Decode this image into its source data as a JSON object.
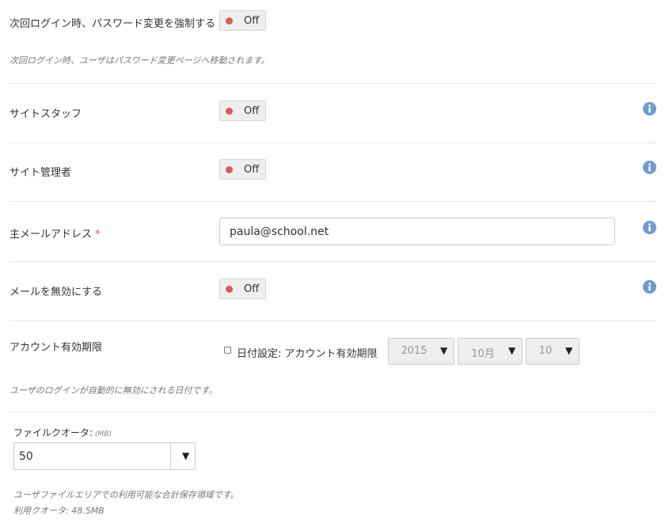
{
  "force_password": {
    "label": "次回ログイン時、パスワード変更を強制する",
    "toggle": "Off",
    "description": "次回ログイン時、ユーザはパスワード変更ページへ移動されます。"
  },
  "site_staff": {
    "label": "サイトスタッフ",
    "toggle": "Off"
  },
  "site_admin": {
    "label": "サイト管理者",
    "toggle": "Off"
  },
  "primary_email": {
    "label": "主メールアドレス",
    "required_mark": "*",
    "value": "paula@school.net"
  },
  "disable_email": {
    "label": "メールを無効にする",
    "toggle": "Off"
  },
  "account_expiry": {
    "label": "アカウント有効期限",
    "checkbox_label": "日付設定: アカウント有効期限",
    "year": "2015",
    "month": "10月",
    "day": "10",
    "description": "ユーザのログインが自動的に無効にされる日付です。"
  },
  "file_quota": {
    "label": "ファイルクオータ:",
    "unit": "(MB)",
    "value": "50",
    "description": "ユーザファイルエリアでの利用可能な合計保存領域です。",
    "usage": "利用クオータ: 48.5MB"
  },
  "icons": {
    "info": "info-circle-icon",
    "caret": "caret-down-icon"
  },
  "colors": {
    "toggle_off_dot": "#e05a5a",
    "info_icon": "#6f9bd1",
    "required": "#d9534f"
  }
}
